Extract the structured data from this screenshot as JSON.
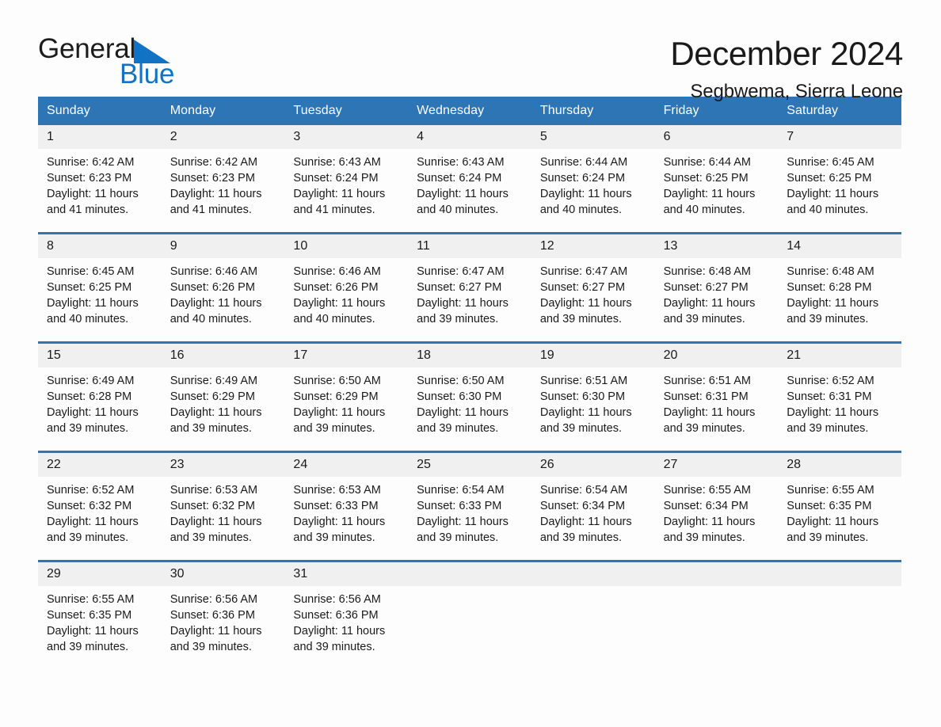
{
  "brand": {
    "name_part1": "General",
    "name_part2": "Blue",
    "triangle_color": "#1272c4",
    "text_color": "#1c1c1c",
    "blue_color": "#1272c4"
  },
  "header": {
    "month_title": "December 2024",
    "location": "Segbwema, Sierra Leone"
  },
  "theme": {
    "header_blue": "#2e75b6",
    "day_band_gray": "#f0f0f0",
    "page_background": "#fdfdfd",
    "text": "#1a1a1a"
  },
  "weekdays": [
    "Sunday",
    "Monday",
    "Tuesday",
    "Wednesday",
    "Thursday",
    "Friday",
    "Saturday"
  ],
  "labels": {
    "sunrise_prefix": "Sunrise:",
    "sunset_prefix": "Sunset:",
    "daylight_prefix": "Daylight:"
  },
  "weeks": [
    [
      {
        "day": "1",
        "sunrise": "Sunrise: 6:42 AM",
        "sunset": "Sunset: 6:23 PM",
        "daylight": "Daylight: 11 hours and 41 minutes."
      },
      {
        "day": "2",
        "sunrise": "Sunrise: 6:42 AM",
        "sunset": "Sunset: 6:23 PM",
        "daylight": "Daylight: 11 hours and 41 minutes."
      },
      {
        "day": "3",
        "sunrise": "Sunrise: 6:43 AM",
        "sunset": "Sunset: 6:24 PM",
        "daylight": "Daylight: 11 hours and 41 minutes."
      },
      {
        "day": "4",
        "sunrise": "Sunrise: 6:43 AM",
        "sunset": "Sunset: 6:24 PM",
        "daylight": "Daylight: 11 hours and 40 minutes."
      },
      {
        "day": "5",
        "sunrise": "Sunrise: 6:44 AM",
        "sunset": "Sunset: 6:24 PM",
        "daylight": "Daylight: 11 hours and 40 minutes."
      },
      {
        "day": "6",
        "sunrise": "Sunrise: 6:44 AM",
        "sunset": "Sunset: 6:25 PM",
        "daylight": "Daylight: 11 hours and 40 minutes."
      },
      {
        "day": "7",
        "sunrise": "Sunrise: 6:45 AM",
        "sunset": "Sunset: 6:25 PM",
        "daylight": "Daylight: 11 hours and 40 minutes."
      }
    ],
    [
      {
        "day": "8",
        "sunrise": "Sunrise: 6:45 AM",
        "sunset": "Sunset: 6:25 PM",
        "daylight": "Daylight: 11 hours and 40 minutes."
      },
      {
        "day": "9",
        "sunrise": "Sunrise: 6:46 AM",
        "sunset": "Sunset: 6:26 PM",
        "daylight": "Daylight: 11 hours and 40 minutes."
      },
      {
        "day": "10",
        "sunrise": "Sunrise: 6:46 AM",
        "sunset": "Sunset: 6:26 PM",
        "daylight": "Daylight: 11 hours and 40 minutes."
      },
      {
        "day": "11",
        "sunrise": "Sunrise: 6:47 AM",
        "sunset": "Sunset: 6:27 PM",
        "daylight": "Daylight: 11 hours and 39 minutes."
      },
      {
        "day": "12",
        "sunrise": "Sunrise: 6:47 AM",
        "sunset": "Sunset: 6:27 PM",
        "daylight": "Daylight: 11 hours and 39 minutes."
      },
      {
        "day": "13",
        "sunrise": "Sunrise: 6:48 AM",
        "sunset": "Sunset: 6:27 PM",
        "daylight": "Daylight: 11 hours and 39 minutes."
      },
      {
        "day": "14",
        "sunrise": "Sunrise: 6:48 AM",
        "sunset": "Sunset: 6:28 PM",
        "daylight": "Daylight: 11 hours and 39 minutes."
      }
    ],
    [
      {
        "day": "15",
        "sunrise": "Sunrise: 6:49 AM",
        "sunset": "Sunset: 6:28 PM",
        "daylight": "Daylight: 11 hours and 39 minutes."
      },
      {
        "day": "16",
        "sunrise": "Sunrise: 6:49 AM",
        "sunset": "Sunset: 6:29 PM",
        "daylight": "Daylight: 11 hours and 39 minutes."
      },
      {
        "day": "17",
        "sunrise": "Sunrise: 6:50 AM",
        "sunset": "Sunset: 6:29 PM",
        "daylight": "Daylight: 11 hours and 39 minutes."
      },
      {
        "day": "18",
        "sunrise": "Sunrise: 6:50 AM",
        "sunset": "Sunset: 6:30 PM",
        "daylight": "Daylight: 11 hours and 39 minutes."
      },
      {
        "day": "19",
        "sunrise": "Sunrise: 6:51 AM",
        "sunset": "Sunset: 6:30 PM",
        "daylight": "Daylight: 11 hours and 39 minutes."
      },
      {
        "day": "20",
        "sunrise": "Sunrise: 6:51 AM",
        "sunset": "Sunset: 6:31 PM",
        "daylight": "Daylight: 11 hours and 39 minutes."
      },
      {
        "day": "21",
        "sunrise": "Sunrise: 6:52 AM",
        "sunset": "Sunset: 6:31 PM",
        "daylight": "Daylight: 11 hours and 39 minutes."
      }
    ],
    [
      {
        "day": "22",
        "sunrise": "Sunrise: 6:52 AM",
        "sunset": "Sunset: 6:32 PM",
        "daylight": "Daylight: 11 hours and 39 minutes."
      },
      {
        "day": "23",
        "sunrise": "Sunrise: 6:53 AM",
        "sunset": "Sunset: 6:32 PM",
        "daylight": "Daylight: 11 hours and 39 minutes."
      },
      {
        "day": "24",
        "sunrise": "Sunrise: 6:53 AM",
        "sunset": "Sunset: 6:33 PM",
        "daylight": "Daylight: 11 hours and 39 minutes."
      },
      {
        "day": "25",
        "sunrise": "Sunrise: 6:54 AM",
        "sunset": "Sunset: 6:33 PM",
        "daylight": "Daylight: 11 hours and 39 minutes."
      },
      {
        "day": "26",
        "sunrise": "Sunrise: 6:54 AM",
        "sunset": "Sunset: 6:34 PM",
        "daylight": "Daylight: 11 hours and 39 minutes."
      },
      {
        "day": "27",
        "sunrise": "Sunrise: 6:55 AM",
        "sunset": "Sunset: 6:34 PM",
        "daylight": "Daylight: 11 hours and 39 minutes."
      },
      {
        "day": "28",
        "sunrise": "Sunrise: 6:55 AM",
        "sunset": "Sunset: 6:35 PM",
        "daylight": "Daylight: 11 hours and 39 minutes."
      }
    ],
    [
      {
        "day": "29",
        "sunrise": "Sunrise: 6:55 AM",
        "sunset": "Sunset: 6:35 PM",
        "daylight": "Daylight: 11 hours and 39 minutes."
      },
      {
        "day": "30",
        "sunrise": "Sunrise: 6:56 AM",
        "sunset": "Sunset: 6:36 PM",
        "daylight": "Daylight: 11 hours and 39 minutes."
      },
      {
        "day": "31",
        "sunrise": "Sunrise: 6:56 AM",
        "sunset": "Sunset: 6:36 PM",
        "daylight": "Daylight: 11 hours and 39 minutes."
      },
      {
        "day": "",
        "sunrise": "",
        "sunset": "",
        "daylight": ""
      },
      {
        "day": "",
        "sunrise": "",
        "sunset": "",
        "daylight": ""
      },
      {
        "day": "",
        "sunrise": "",
        "sunset": "",
        "daylight": ""
      },
      {
        "day": "",
        "sunrise": "",
        "sunset": "",
        "daylight": ""
      }
    ]
  ]
}
